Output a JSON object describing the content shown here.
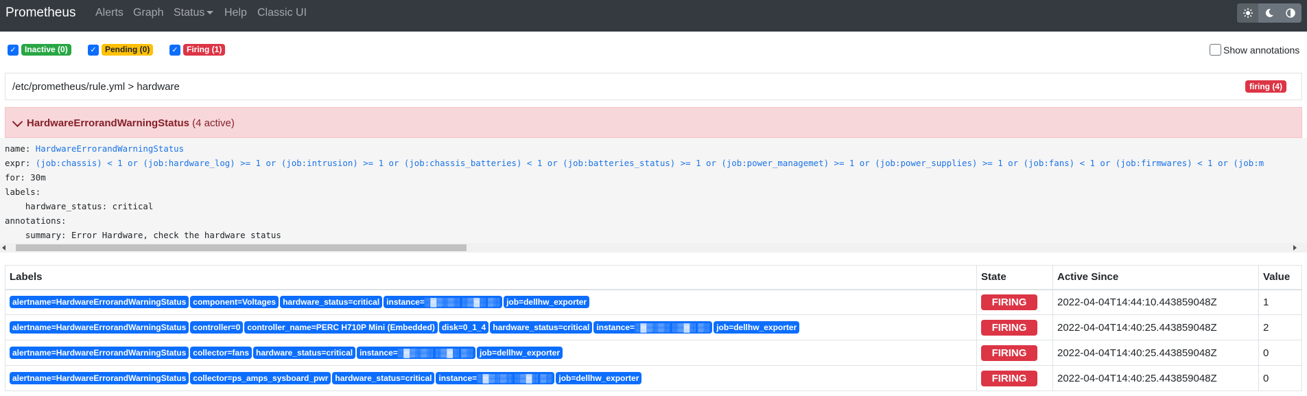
{
  "navbar": {
    "brand": "Prometheus",
    "links": [
      "Alerts",
      "Graph",
      "Status",
      "Help",
      "Classic UI"
    ],
    "theme_buttons": [
      "sun-icon",
      "moon-icon",
      "contrast-icon"
    ]
  },
  "filters": {
    "inactive": "Inactive (0)",
    "pending": "Pending (0)",
    "firing": "Firing (1)",
    "show_annotations": "Show annotations"
  },
  "group": {
    "path": "/etc/prometheus/rule.yml > hardware",
    "badge": "firing (4)"
  },
  "alert": {
    "name": "HardwareErrorandWarningStatus",
    "active": "(4 active)",
    "yaml": {
      "name_key": "name: ",
      "name_value": "HardwareErrorandWarningStatus",
      "expr_key": "expr: ",
      "expr_value": "(job:chassis) < 1 or (job:hardware_log) >= 1 or (job:intrusion) >= 1 or (job:chassis_batteries) < 1 or (job:batteries_status) >= 1 or (job:power_managemet) >= 1 or (job:power_supplies) >= 1 or (job:fans) < 1 or (job:firmwares) < 1 or (job:m",
      "for": "for: 30m",
      "labels": "labels:",
      "label_line": "  hardware_status: critical",
      "annotations": "annotations:",
      "summary_line": "  summary: Error Hardware, check the hardware status"
    }
  },
  "table": {
    "headers": [
      "Labels",
      "State",
      "Active Since",
      "Value"
    ],
    "rows": [
      {
        "labels": [
          "alertname=HardwareErrorandWarningStatus",
          "component=Voltages",
          "hardware_status=critical",
          "instance=░▓▒░▒░ ░▒▓░ ▒░",
          "job=dellhw_exporter"
        ],
        "state": "FIRING",
        "active_since": "2022-04-04T14:44:10.443859048Z",
        "value": "1"
      },
      {
        "labels": [
          "alertname=HardwareErrorandWarningStatus",
          "controller=0",
          "controller_name=PERC H710P Mini (Embedded)",
          "disk=0_1_4",
          "hardware_status=critical",
          "instance=░▓▒░▒░ ░▒▓░ ▒░",
          "job=dellhw_exporter"
        ],
        "state": "FIRING",
        "active_since": "2022-04-04T14:40:25.443859048Z",
        "value": "2"
      },
      {
        "labels": [
          "alertname=HardwareErrorandWarningStatus",
          "collector=fans",
          "hardware_status=critical",
          "instance=░▓▒░▒░ ░▒▓░ ▒░",
          "job=dellhw_exporter"
        ],
        "state": "FIRING",
        "active_since": "2022-04-04T14:40:25.443859048Z",
        "value": "0"
      },
      {
        "labels": [
          "alertname=HardwareErrorandWarningStatus",
          "collector=ps_amps_sysboard_pwr",
          "hardware_status=critical",
          "instance=░▓▒░▒░ ░▒▓░ ▒░",
          "job=dellhw_exporter"
        ],
        "state": "FIRING",
        "active_since": "2022-04-04T14:40:25.443859048Z",
        "value": "0"
      }
    ]
  },
  "colors": {
    "navbar": "#343a40",
    "firing": "#dc3545",
    "label": "#0d6efd",
    "alert_bg": "#f8d7da"
  }
}
